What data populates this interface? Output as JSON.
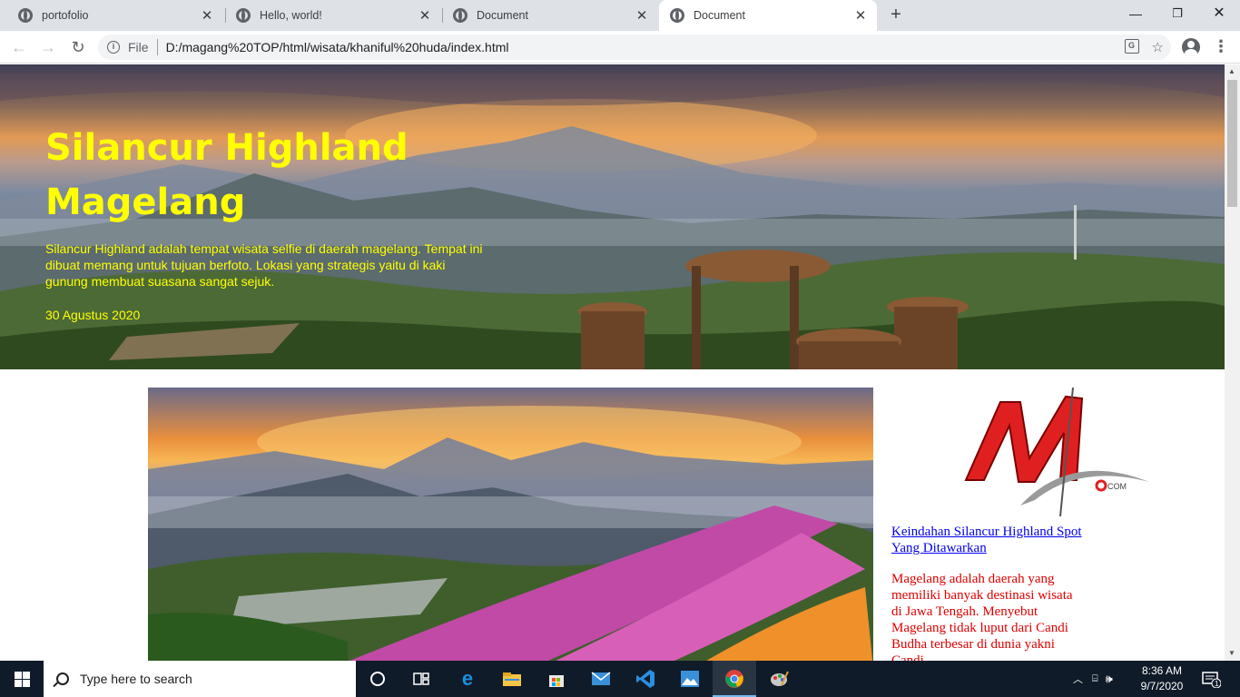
{
  "browser": {
    "tabs": [
      {
        "title": "portofolio",
        "active": false
      },
      {
        "title": "Hello, world!",
        "active": false
      },
      {
        "title": "Document",
        "active": false
      },
      {
        "title": "Document",
        "active": true
      }
    ],
    "url_scheme_label": "File",
    "url": "D:/magang%20TOP/html/wisata/khaniful%20huda/index.html",
    "new_tab_symbol": "+"
  },
  "hero": {
    "title": "Silancur Highland Magelang",
    "description": "Silancur Highland adalah tempat wisata selfie di daerah magelang. Tempat ini dibuat memang untuk tujuan berfoto. Lokasi yang strategis yaitu di kaki gunung membuat suasana sangat sejuk.",
    "date": "30 Agustus 2020"
  },
  "sidebar": {
    "logo_text": "OCOM",
    "link_text": "Keindahan Silancur Highland Spot Yang Ditawarkan",
    "paragraph": "Magelang adalah daerah yang memiliki banyak destinasi wisata di Jawa Tengah. Menyebut Magelang tidak luput dari Candi Budha terbesar di dunia yakni Candi"
  },
  "taskbar": {
    "search_placeholder": "Type here to search",
    "time": "8:36 AM",
    "date": "9/7/2020",
    "notification_count": "1"
  },
  "colors": {
    "hero_text": "#ffff00",
    "link": "#0000ee",
    "paragraph": "#e00000",
    "taskbar": "#101b29"
  }
}
